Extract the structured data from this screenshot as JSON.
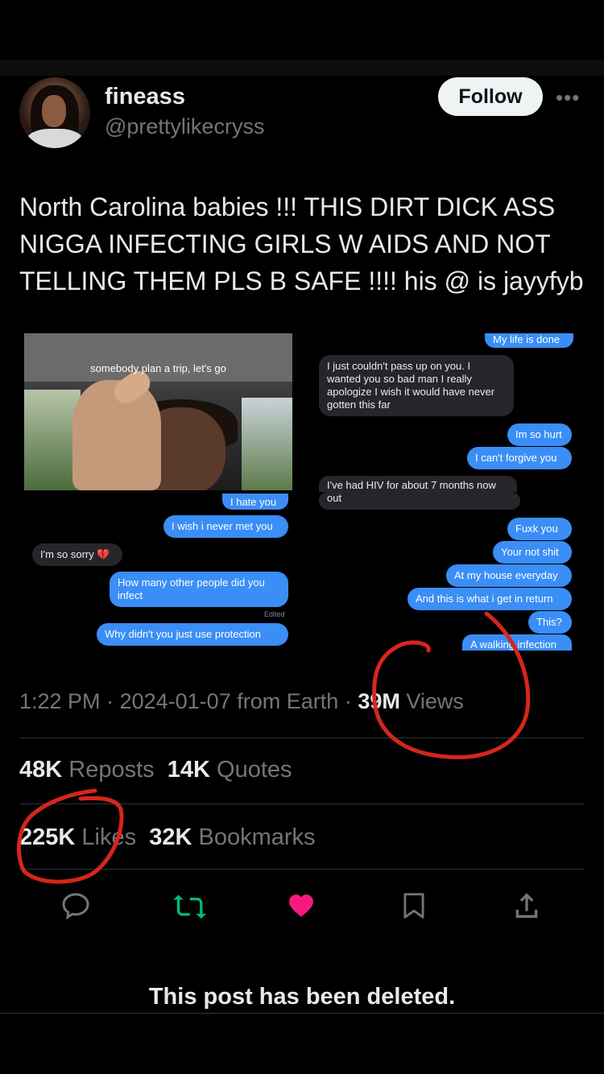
{
  "author": {
    "name": "fineass",
    "handle": "@prettylikecryss",
    "follow_label": "Follow",
    "more_label": "•••"
  },
  "tweet": {
    "text": "North Carolina babies !!! THIS DIRT DICK ASS NIGGA INFECTING GIRLS W AIDS AND NOT TELLING THEM PLS B SAFE !!!! his @ is jayyfyb"
  },
  "media": {
    "photo_caption": "somebody plan a trip, let's go",
    "left_thread": [
      {
        "from": "me",
        "text": "I hate you"
      },
      {
        "from": "me",
        "text": "I wish i never met you"
      },
      {
        "from": "them",
        "text": "I'm so sorry 💔"
      },
      {
        "from": "me",
        "text": "How many other people did you infect"
      },
      {
        "from": "me",
        "text": "Why didn't you just use protection"
      }
    ],
    "left_edited": "Edited",
    "right_thread": [
      {
        "from": "me",
        "text": "My life is done"
      },
      {
        "from": "them",
        "text": "I just couldn't pass up on you. I wanted you so bad man I really apologize I wish it would have never gotten this far"
      },
      {
        "from": "me",
        "text": "Im so hurt"
      },
      {
        "from": "me",
        "text": "I can't forgive you"
      },
      {
        "from": "them",
        "text": "I've had HIV for about 7 months now"
      },
      {
        "from": "them",
        "text": "out"
      },
      {
        "from": "me",
        "text": "Fuxk you"
      },
      {
        "from": "me",
        "text": "Your not shit"
      },
      {
        "from": "me",
        "text": "At my house everyday"
      },
      {
        "from": "me",
        "text": "And this is what i get in return"
      },
      {
        "from": "me",
        "text": "This?"
      },
      {
        "from": "me",
        "text": "A walking infection"
      }
    ]
  },
  "meta": {
    "time": "1:22 PM",
    "sep1": "·",
    "date": "2024-01-07",
    "from": "from Earth",
    "sep2": "·",
    "views_count": "39M",
    "views_label": "Views"
  },
  "stats": {
    "reposts_count": "48K",
    "reposts_label": "Reposts",
    "quotes_count": "14K",
    "quotes_label": "Quotes",
    "likes_count": "225K",
    "likes_label": "Likes",
    "bookmarks_count": "32K",
    "bookmarks_label": "Bookmarks"
  },
  "actions": {
    "reply_icon": "reply-icon",
    "repost_icon": "repost-icon",
    "like_icon": "heart-icon",
    "bookmark_icon": "bookmark-icon",
    "share_icon": "share-icon"
  },
  "colors": {
    "background": "#000000",
    "text": "#e7e9ea",
    "muted": "#71767b",
    "repost_green": "#00ba7c",
    "like_pink": "#f91880",
    "imessage_blue": "#3a8ef6",
    "annotation_red": "#d5261c"
  },
  "notice": {
    "deleted": "This post has been deleted."
  }
}
